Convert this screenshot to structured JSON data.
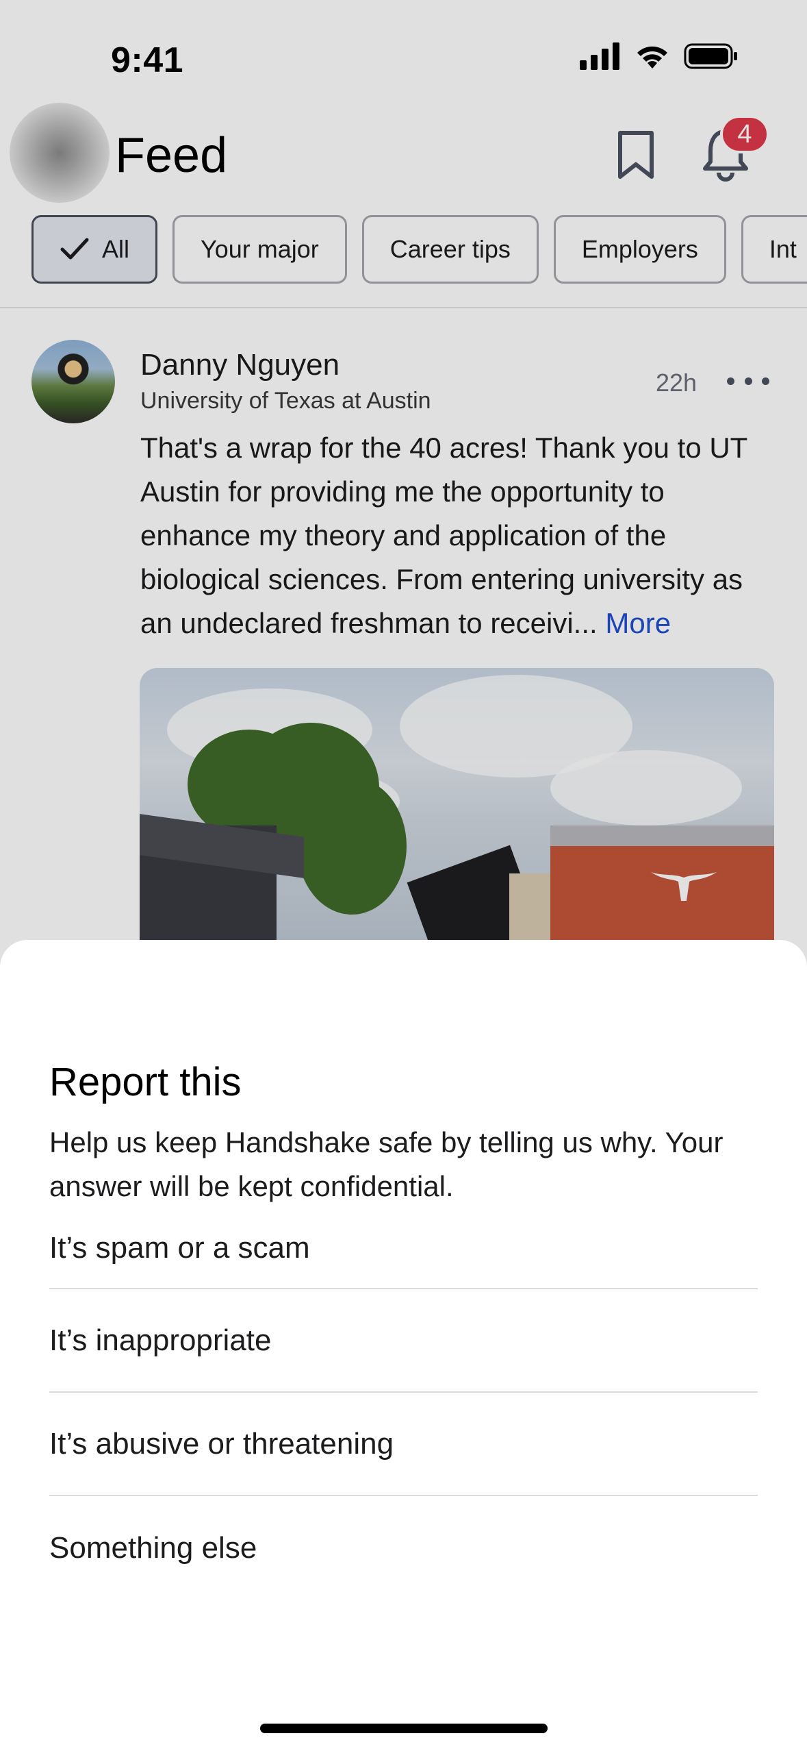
{
  "status_bar": {
    "time": "9:41"
  },
  "header": {
    "title": "Feed",
    "notification_count": "4"
  },
  "filters": [
    {
      "label": "All",
      "active": true
    },
    {
      "label": "Your major",
      "active": false
    },
    {
      "label": "Career tips",
      "active": false
    },
    {
      "label": "Employers",
      "active": false
    },
    {
      "label": "Int",
      "active": false
    }
  ],
  "post": {
    "author": "Danny Nguyen",
    "school": "University of Texas at Austin",
    "time": "22h",
    "body": "That's a wrap for the 40 acres! Thank you to UT Austin for providing me the opportunity to enhance my theory and application of the biological sciences. From entering university as an undeclared freshman to receivi...",
    "more_label": "More"
  },
  "report_sheet": {
    "title": "Report this",
    "description": "Help us keep Handshake safe by telling us why. Your answer will be kept confidential.",
    "options": [
      "It’s spam or a scam",
      "It’s inappropriate",
      "It’s abusive or threatening",
      "Something else"
    ]
  },
  "colors": {
    "accent_link": "#1f4fd1",
    "badge": "#e03a4b",
    "active_chip_bg": "#e5e8f1"
  }
}
